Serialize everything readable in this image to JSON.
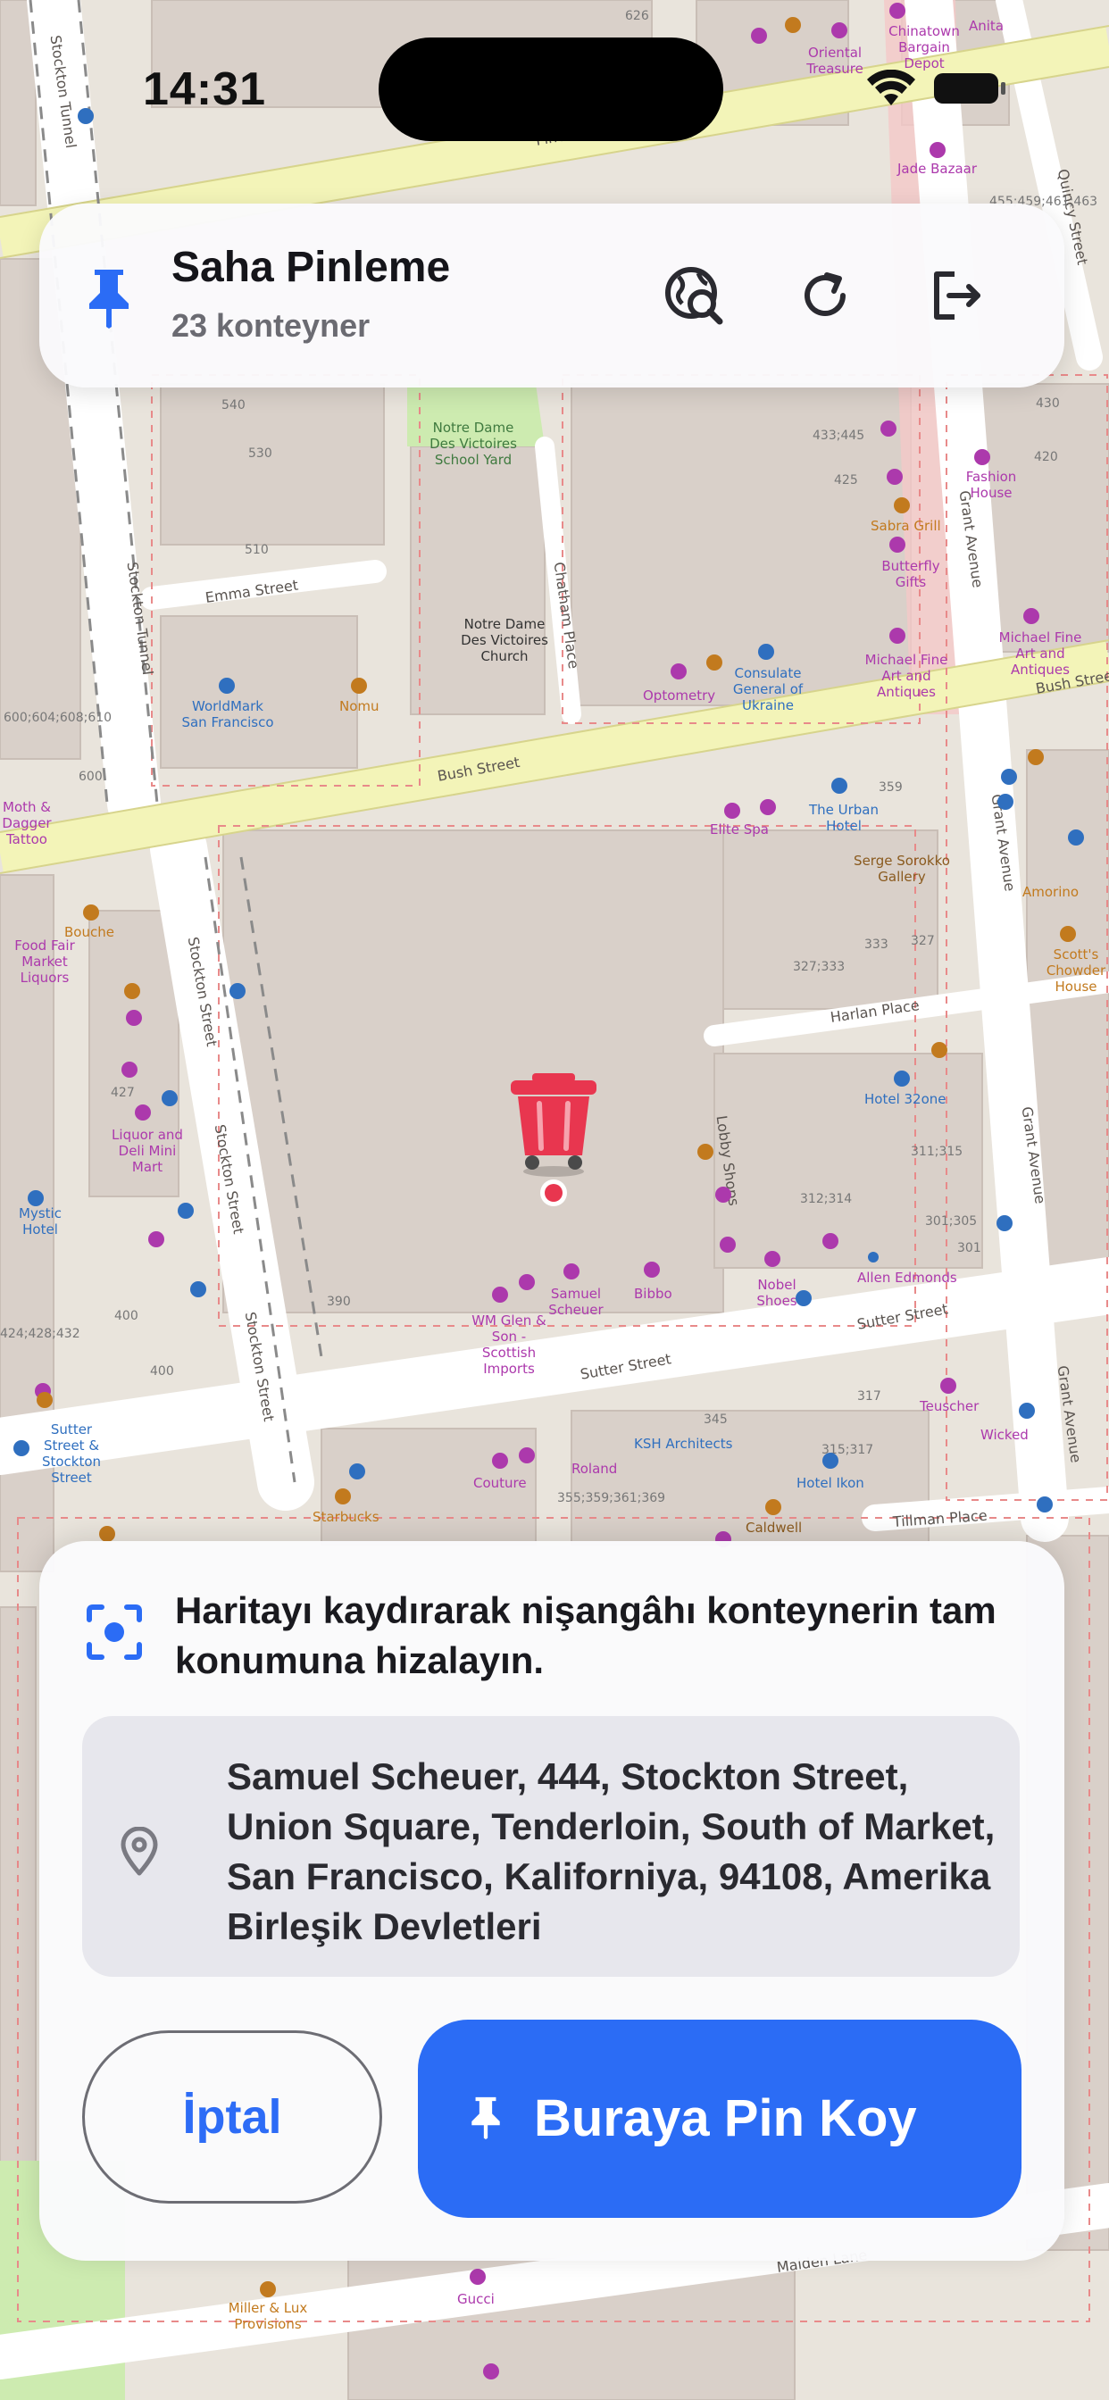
{
  "status_bar": {
    "time": "14:31"
  },
  "header": {
    "title": "Saha Pinleme",
    "subtitle": "23 konteyner",
    "actions": [
      "globe-search-icon",
      "refresh-icon",
      "logout-icon"
    ]
  },
  "map": {
    "streets": [
      "Pine Street",
      "Emma Street",
      "Bush Street",
      "Bush Street",
      "Sutter Street",
      "Sutter Street",
      "Stockton Tunnel",
      "Stockton Tunnel",
      "Stockton Street",
      "Stockton Street",
      "Stockton Street",
      "Chatham Place",
      "Grant Avenue",
      "Grant Avenue",
      "Grant Avenue",
      "Grant Avenue",
      "Quincy Street",
      "Harlan Place",
      "Tillman Place",
      "Maiden Lane",
      "Lobby Shops"
    ],
    "places": [
      "Notre Dame Des Victoires School Yard",
      "Notre Dame Des Victoires Church",
      "WorldMark San Francisco",
      "Nomu",
      "Optometry",
      "Consulate General of Ukraine",
      "Michael Fine Art and Antiques",
      "Michael Fine Art and Antiques",
      "Sabra Grill",
      "Butterfly Gifts",
      "Fashion House",
      "Jade Bazaar",
      "Chinatown Bargain Depot",
      "Oriental Treasure",
      "Anita",
      "Elite Spa",
      "The Urban Hotel",
      "Serge Sorokko Gallery",
      "Amorino",
      "Scott's Chowder House",
      "Hotel 32one",
      "Allen Edmonds",
      "Nobel Shoes",
      "Samuel Scheuer",
      "Bibbo",
      "WM Glen & Son - Scottish Imports",
      "Mystic Hotel",
      "Food Fair Market Liquors",
      "Bouche",
      "Liquor and Deli Mini Mart",
      "Moth & Dagger Tattoo",
      "Sutter Street & Stockton Street",
      "Starbucks",
      "Couture",
      "Roland",
      "KSH Architects",
      "Hotel Ikon",
      "Caldwell",
      "Teuscher",
      "Wicked",
      "Miller & Lux Provisions",
      "Gucci"
    ],
    "numbers": [
      "626",
      "540",
      "530",
      "510",
      "433;445",
      "425",
      "430",
      "420",
      "359",
      "333",
      "327",
      "327;333",
      "311;315",
      "312;314",
      "301;305",
      "301",
      "390",
      "400",
      "400",
      "427",
      "345",
      "317",
      "315;317",
      "355;359;361;369",
      "600;604;608;610",
      "600",
      "424;428;432",
      "455;459;461;463"
    ],
    "colors": {
      "land": "#e9e4dc",
      "building": "#d9d0c9",
      "road": "#ffffff",
      "major_road": "#f6f7c4",
      "park": "#cdebb0",
      "poi": "#ac39ac"
    }
  },
  "marker": {
    "type": "trash-bin-icon",
    "color": "#e8364f"
  },
  "sheet": {
    "hint": "Haritayı kaydırarak nişangâhı konteynerin tam konumuna hizalayın.",
    "address": "Samuel Scheuer, 444, Stockton Street, Union Square, Tenderloin, South of Market, San Francisco, Kaliforniya, 94108, Amerika Birleşik Devletleri",
    "cancel_label": "İptal",
    "confirm_label": "Buraya Pin Koy",
    "accent": "#2b6cf5"
  }
}
